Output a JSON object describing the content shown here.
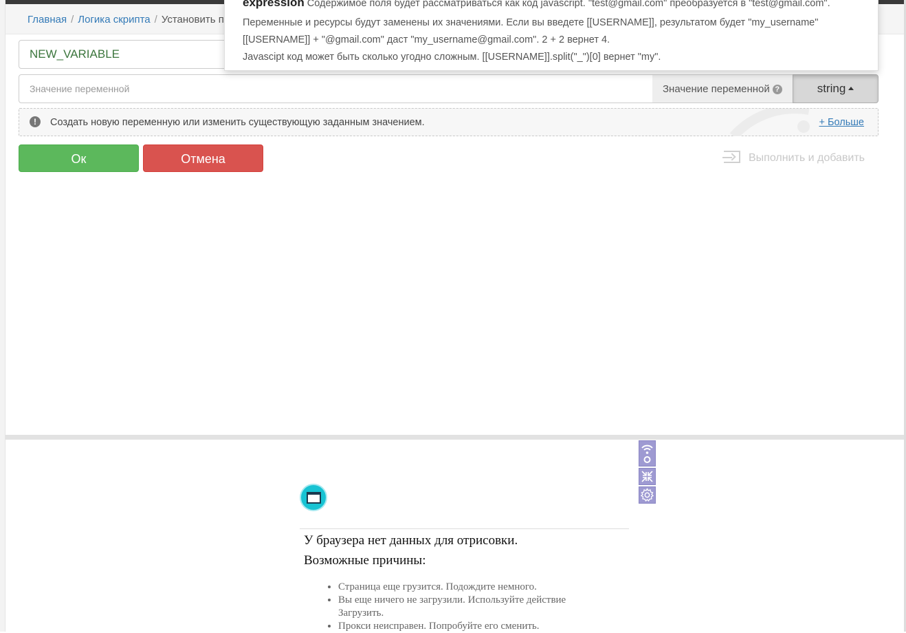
{
  "breadcrumb": {
    "home": "Главная",
    "logic": "Логика скрипта",
    "current": "Установить п"
  },
  "tooltip": {
    "line1_bold": "expression",
    "line1_rest": " Содержимое поля будет рассматриваться как код javascript. \"test@gmail.com\" преобразуется в \"test@gmail.com\".",
    "line2": "Переменные и ресурсы будут заменены их значениями. Если вы введете [[USERNAME]], результатом будет \"my_username\"",
    "line3": "[[USERNAME]] + \"@gmail.com\" даст \"my_username@gmail.com\". 2 + 2 вернет 4.",
    "line4": "Javascipt код может быть сколько угодно сложным. [[USERNAME]].split(\"_\")[0] вернет \"my\"."
  },
  "form": {
    "variable_name": "NEW_VARIABLE",
    "value_placeholder": "Значение переменной",
    "value_label": "Значение переменной",
    "help_glyph": "?",
    "type_button": "string"
  },
  "info": {
    "icon_glyph": "!",
    "text": "Создать новую переменную или изменить существующую заданным значением.",
    "more_link": "+ Больше"
  },
  "actions": {
    "ok": "Ок",
    "cancel": "Отмена",
    "execute_add": "Выполнить и добавить"
  },
  "browser_panel": {
    "title": "У браузера нет данных для отрисовки.",
    "subtitle": "Возможные причины:",
    "reasons": [
      "Страница еще грузится. Подождите немного.",
      "Вы еще ничего не загрузили. Используйте действие Загрузить.",
      "Прокси неисправен. Попробуйте его сменить."
    ]
  },
  "colors": {
    "ok": "#5cb85c",
    "cancel": "#d9534f",
    "link": "#337ab7",
    "variable_text": "#3c763d",
    "tool_buttons": "#9e9ad2",
    "browser_logo": "#18c3d3"
  },
  "icons": [
    "help-icon",
    "exclamation-icon",
    "execute-add-icon",
    "wifi-record-icon",
    "collapse-icon",
    "settings-gear-icon",
    "browser-logo-icon"
  ]
}
